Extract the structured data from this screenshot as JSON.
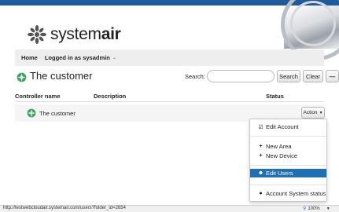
{
  "brand": {
    "logo_text_light": "system",
    "logo_text_bold": "air"
  },
  "nav": {
    "home": "Home",
    "user": "Logged in as sysadmin"
  },
  "page": {
    "title": "The customer"
  },
  "search": {
    "label": "Search:",
    "value": "",
    "placeholder": "",
    "button": "Search",
    "clear": "Clear",
    "collapse": "—"
  },
  "table": {
    "headers": {
      "name": "Controller name",
      "description": "Description",
      "status": "Status"
    },
    "rows": [
      {
        "name": "The customer",
        "description": "",
        "status": "",
        "action": "Action"
      }
    ]
  },
  "dropdown": {
    "items": [
      {
        "icon": "edit-icon",
        "glyph": "☑",
        "label": "Edit Account"
      },
      {
        "icon": "plus-icon",
        "glyph": "+",
        "label": "New Area"
      },
      {
        "icon": "plus-icon",
        "glyph": "+",
        "label": "New Device"
      },
      {
        "icon": "user-icon",
        "glyph": "☻",
        "label": "Edit Users",
        "active": true
      },
      {
        "icon": "info-icon",
        "glyph": "●",
        "label": "Account System status"
      }
    ]
  },
  "status_bar": {
    "url": "http://testwebcloudair.systemair.com/users?folder_id=2654",
    "zoom": "100%"
  },
  "colors": {
    "top_bar": "#1e5a9c",
    "active_item": "#1f6fb5",
    "customer_icon": "#3ba55c"
  }
}
